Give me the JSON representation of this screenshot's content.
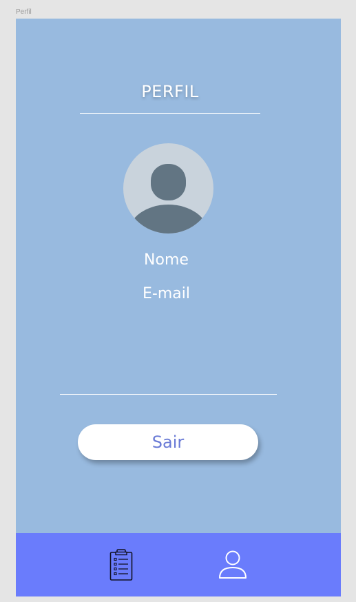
{
  "artboard": {
    "label": "Perfil"
  },
  "header": {
    "title": "PERFIL"
  },
  "profile": {
    "name_label": "Nome",
    "email_label": "E-mail"
  },
  "actions": {
    "logout_label": "Sair"
  },
  "bottom_nav": {
    "items": [
      {
        "icon": "clipboard-list-icon"
      },
      {
        "icon": "user-icon"
      }
    ]
  },
  "colors": {
    "page_background": "#e5e5e5",
    "screen_background": "#98badf",
    "nav_background": "#6a7cfc",
    "button_text": "#6a7bd6",
    "avatar_background": "#c9d3dc",
    "avatar_silhouette": "#627583",
    "text": "#ffffff"
  }
}
